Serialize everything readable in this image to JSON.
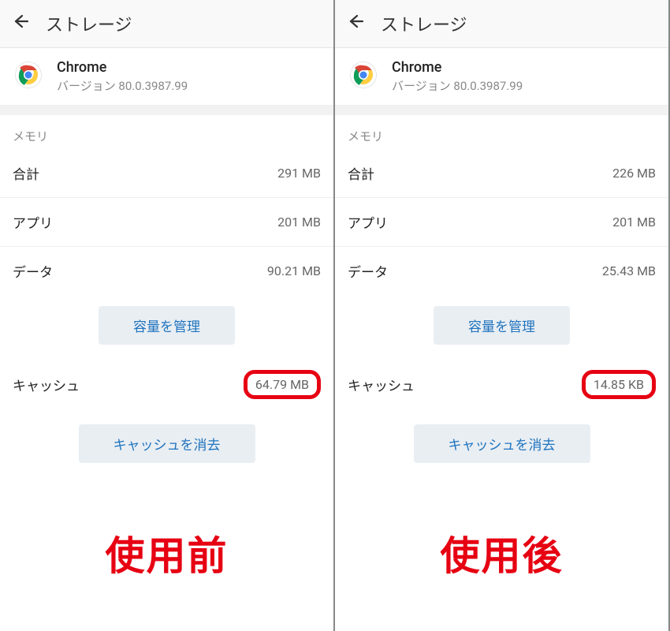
{
  "panels": [
    {
      "title": "ストレージ",
      "app": {
        "name": "Chrome",
        "version_label": "バージョン 80.0.3987.99"
      },
      "memory_header": "メモリ",
      "rows": {
        "total": {
          "label": "合計",
          "value": "291 MB"
        },
        "app": {
          "label": "アプリ",
          "value": "201 MB"
        },
        "data": {
          "label": "データ",
          "value": "90.21 MB"
        },
        "cache": {
          "label": "キャッシュ",
          "value": "64.79 MB"
        }
      },
      "buttons": {
        "manage": "容量を管理",
        "clear_cache": "キャッシュを消去"
      },
      "caption": "使用前"
    },
    {
      "title": "ストレージ",
      "app": {
        "name": "Chrome",
        "version_label": "バージョン 80.0.3987.99"
      },
      "memory_header": "メモリ",
      "rows": {
        "total": {
          "label": "合計",
          "value": "226 MB"
        },
        "app": {
          "label": "アプリ",
          "value": "201 MB"
        },
        "data": {
          "label": "データ",
          "value": "25.43 MB"
        },
        "cache": {
          "label": "キャッシュ",
          "value": "14.85 KB"
        }
      },
      "buttons": {
        "manage": "容量を管理",
        "clear_cache": "キャッシュを消去"
      },
      "caption": "使用後"
    }
  ]
}
